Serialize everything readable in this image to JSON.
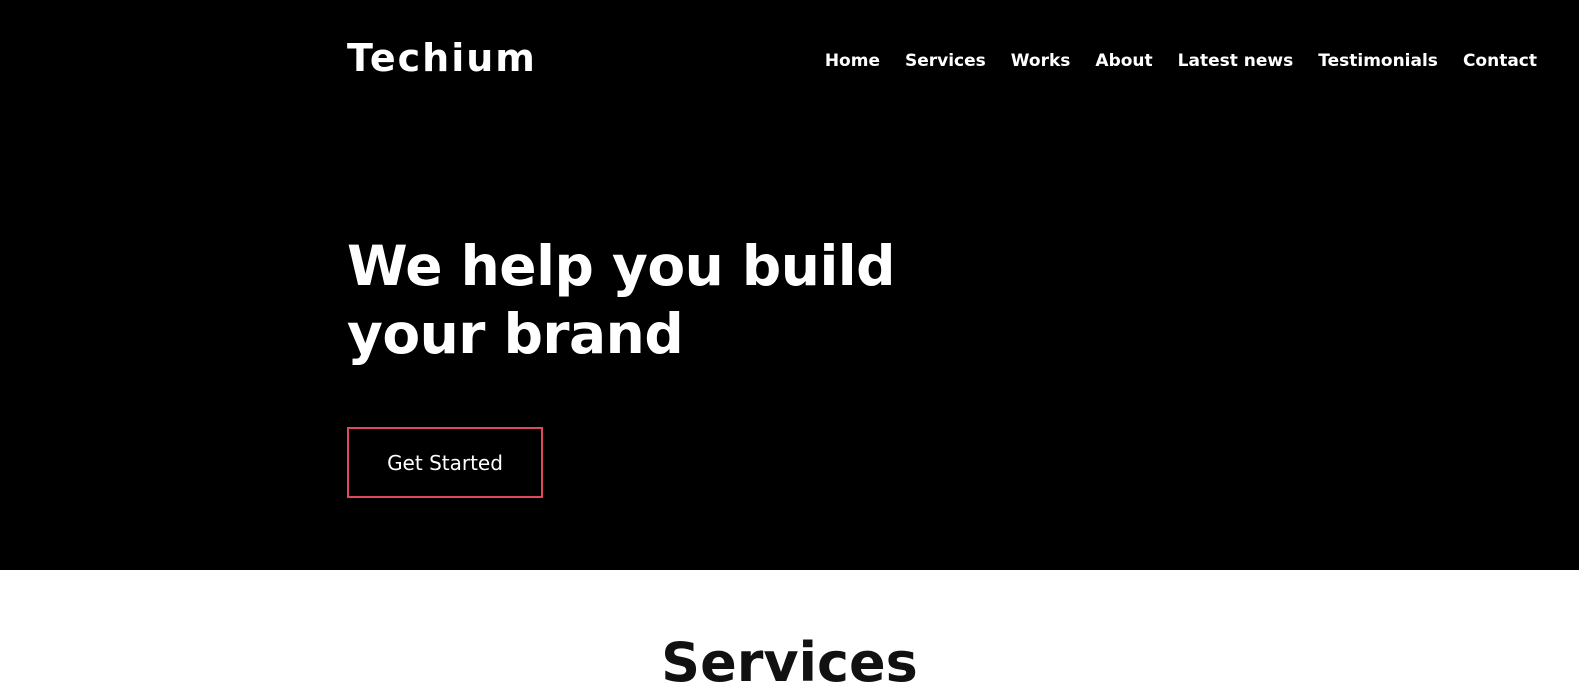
{
  "brand": {
    "logo_text": "Techium"
  },
  "nav": {
    "items": [
      {
        "label": "Home"
      },
      {
        "label": "Services"
      },
      {
        "label": "Works"
      },
      {
        "label": "About"
      },
      {
        "label": "Latest news"
      },
      {
        "label": "Testimonials"
      },
      {
        "label": "Contact"
      }
    ]
  },
  "hero": {
    "headline": "We help you build your brand",
    "cta_label": "Get Started"
  },
  "services": {
    "title": "Services"
  },
  "colors": {
    "hero_background": "#000000",
    "accent": "#e0485d",
    "text_light": "#ffffff",
    "text_dark": "#111111"
  }
}
